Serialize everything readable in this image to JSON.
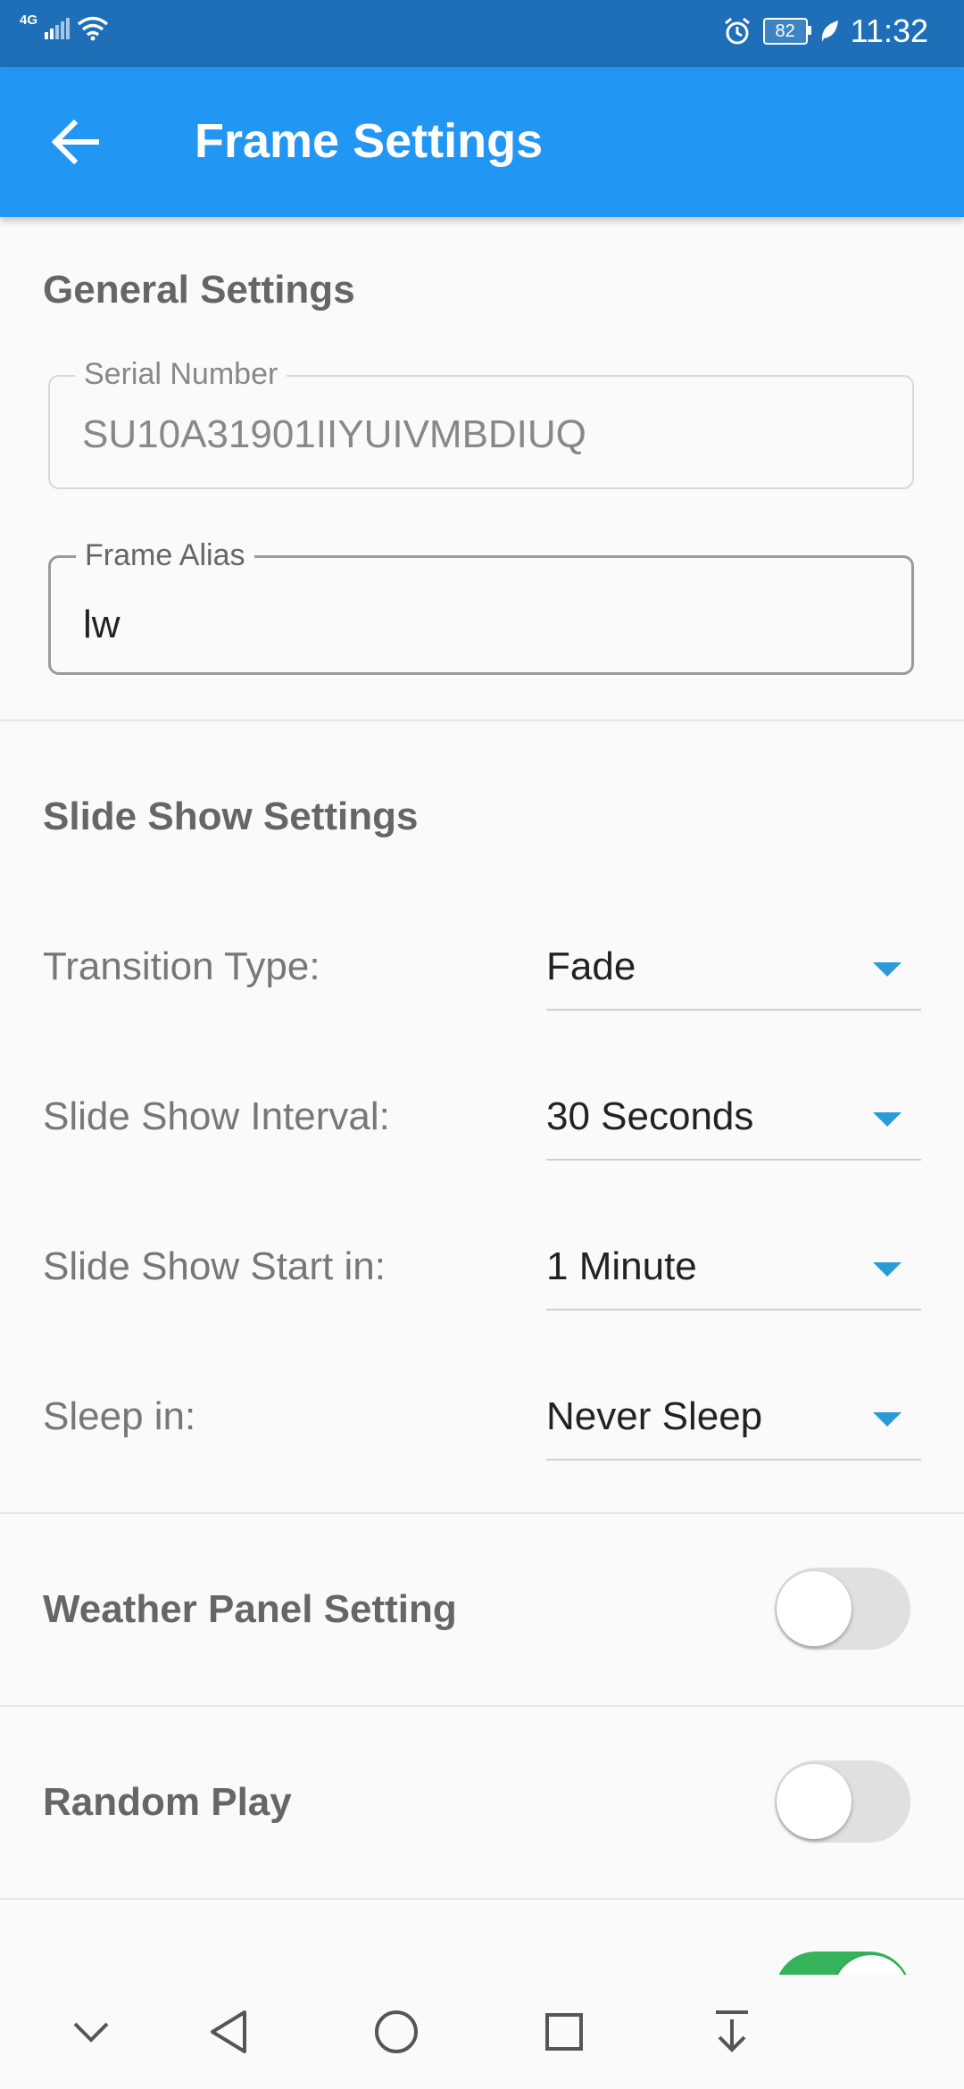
{
  "status_bar": {
    "network": "4G",
    "battery": "82",
    "time": "11:32"
  },
  "app_bar": {
    "title": "Frame Settings"
  },
  "general": {
    "title": "General Settings",
    "serial_label": "Serial Number",
    "serial_value": "SU10A31901IIYUIVMBDIUQ",
    "alias_label": "Frame Alias",
    "alias_value": "lw"
  },
  "slideshow": {
    "title": "Slide Show Settings",
    "rows": [
      {
        "label": "Transition Type:",
        "value": "Fade"
      },
      {
        "label": "Slide Show Interval:",
        "value": "30 Seconds"
      },
      {
        "label": "Slide Show Start in:",
        "value": "1 Minute"
      },
      {
        "label": "Sleep in:",
        "value": "Never Sleep"
      }
    ]
  },
  "toggles": [
    {
      "label": "Weather Panel Setting",
      "on": false
    },
    {
      "label": "Random Play",
      "on": false
    },
    {
      "label": "",
      "on": true
    }
  ],
  "colors": {
    "status_bar": "#1e6fb8",
    "app_bar": "#2196f3",
    "accent": "#2a9bd8",
    "toggle_on": "#35b35a"
  }
}
